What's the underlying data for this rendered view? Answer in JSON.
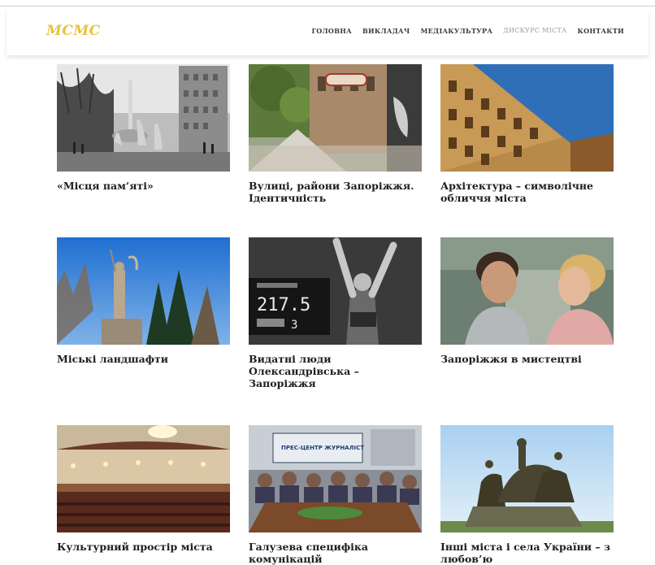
{
  "site": {
    "logo": "MCMC"
  },
  "nav": {
    "items": [
      {
        "label": "ГОЛОВНА",
        "active": false
      },
      {
        "label": "ВИКЛАДАЧ",
        "active": false
      },
      {
        "label": "МЕДІАКУЛЬТУРА",
        "active": false
      },
      {
        "label": "ДИСКУРС МІСТА",
        "active": true
      },
      {
        "label": "КОНТАКТИ",
        "active": false
      }
    ]
  },
  "cards": [
    {
      "title": "«Місця пам’яті»",
      "image": "bw-square-fountain-photo"
    },
    {
      "title": "Вулиці, райони Запоріжжя. Ідентичність",
      "image": "street-photo"
    },
    {
      "title": "Архітектура – символічне обличчя міста",
      "image": "building-facade-photo"
    },
    {
      "title": "Міські ландшафти",
      "image": "monument-landscape-photo"
    },
    {
      "title": "Видатні люди Олександрівська – Запоріжжя",
      "image": "weightlifter-photo",
      "scoreboard": "217.5",
      "scoreboard_small": "3"
    },
    {
      "title": "Запоріжжя в мистецтві",
      "image": "film-still-photo"
    },
    {
      "title": "Культурний простір міста",
      "image": "concert-hall-photo"
    },
    {
      "title": "Галузева специфіка комунікацій",
      "image": "press-center-photo",
      "banner": "ПРЕС-ЦЕНТР ЖУРНАЛІСТ"
    },
    {
      "title": "Інші міста і села України – з любов’ю",
      "image": "cossack-monument-photo"
    }
  ]
}
